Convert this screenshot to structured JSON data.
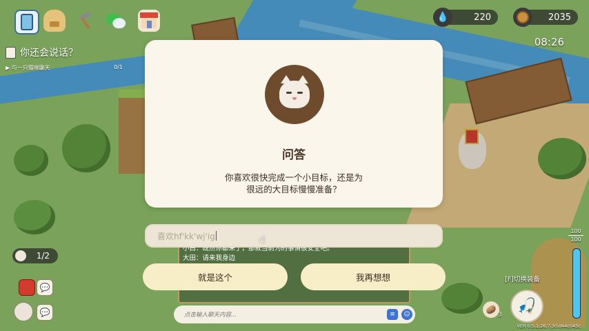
{
  "hud": {
    "top_icons": [
      "phone-icon",
      "backpack-icon",
      "hammer-icon",
      "chat-bubbles-icon",
      "shop-icon"
    ],
    "water": "220",
    "coins": "2035",
    "timer": "08:26"
  },
  "quest": {
    "title": "你还会说话？",
    "subtitle": "与一只猫咪聊天",
    "progress": "0/1"
  },
  "dialog": {
    "title": "问答",
    "question_line1": "你喜欢很快完成一个小目标，还是为",
    "question_line2": "很远的大目标慢慢准备？"
  },
  "answer_input": {
    "value": "喜欢hf'kk'wj'ig"
  },
  "buttons": {
    "confirm": "就是这个",
    "rethink": "我再想想"
  },
  "chat": {
    "lines": [
      "小白：既然你都来了，那就当前为的事情很安全吧。",
      "大田：请来我身边",
      "",
      "",
      "",
      "猫猫：新朋友在哪呀？去看看。"
    ],
    "input_placeholder": "点击输入聊天内容..."
  },
  "pager": "1/2",
  "equip_hint": "[F]切换装备",
  "energy": {
    "current": "100",
    "max": "100",
    "fill_fraction": 1.0
  },
  "bag_count": "3",
  "version": "VER 0.5.1.26.7.30.d44c045c",
  "colors": {
    "card_bg": "#fbf6ec",
    "button_bg": "#f7eec7",
    "avatar_bg": "#6e4b2c",
    "river": "#4fa4de",
    "grass": "#8fc06a"
  }
}
